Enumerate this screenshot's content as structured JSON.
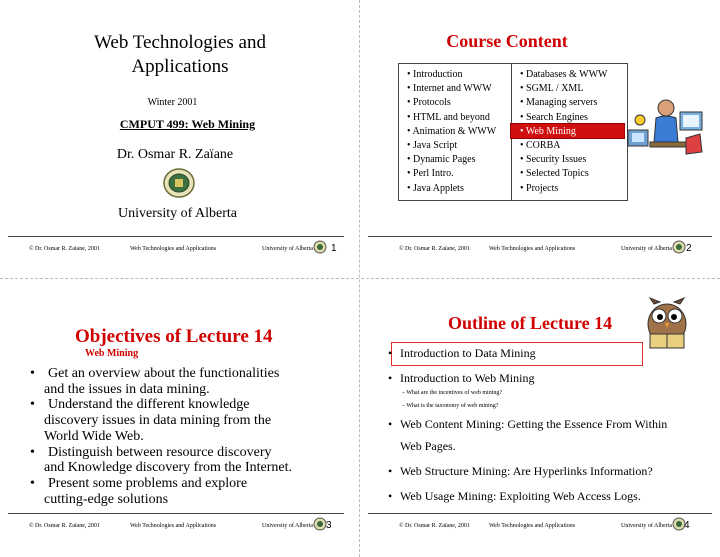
{
  "slide1": {
    "title_line1": "Web Technologies and",
    "title_line2": "Applications",
    "term": "Winter 2001",
    "course": "CMPUT 499: Web Mining",
    "author": "Dr. Osmar R. Zaïane",
    "university": "University of Alberta"
  },
  "slide2": {
    "title": "Course Content",
    "col1": [
      "Introduction",
      "Internet and WWW",
      "Protocols",
      "HTML and beyond",
      "Animation & WWW",
      "Java Script",
      "Dynamic Pages",
      "Perl  Intro.",
      "Java Applets"
    ],
    "col2": [
      "Databases & WWW",
      "SGML / XML",
      "Managing servers",
      "Search Engines",
      "Web Mining",
      "CORBA",
      "Security Issues",
      "Selected Topics",
      "Projects"
    ],
    "highlight_color": "#d01010"
  },
  "slide3": {
    "title": "Objectives of Lecture 14",
    "subtitle": "Web Mining",
    "bullets": [
      [
        "Get an overview about the functionalities",
        "and the issues in data mining."
      ],
      [
        "Understand the different knowledge",
        "discovery issues in data mining from the",
        "World Wide Web."
      ],
      [
        "Distinguish between resource discovery",
        "and Knowledge discovery from the Internet."
      ],
      [
        "Present some problems and explore",
        "cutting-edge solutions"
      ]
    ]
  },
  "slide4": {
    "title": "Outline of Lecture 14",
    "items": [
      {
        "text": "Introduction to Data Mining",
        "sub": []
      },
      {
        "text": "Introduction to Web Mining",
        "sub": [
          "What are the incentives of web mining?",
          "What is the taxonomy of web mining?"
        ]
      },
      {
        "text": "Web Content Mining: Getting the Essence From Within",
        "text2": "Web Pages.",
        "sub": []
      },
      {
        "text": "Web Structure Mining: Are Hyperlinks Information?",
        "sub": []
      },
      {
        "text": "Web Usage Mining:  Exploiting Web Access Logs.",
        "sub": []
      }
    ]
  },
  "footer": {
    "copyright": "© Dr. Osmar R. Zaïane, 2001",
    "course": "Web Technologies and Applications",
    "university": "University  of  Alberta",
    "pages": [
      "1",
      "2",
      "3",
      "4"
    ]
  },
  "colors": {
    "title_red": "#d00000",
    "accent_red": "#d01010"
  }
}
